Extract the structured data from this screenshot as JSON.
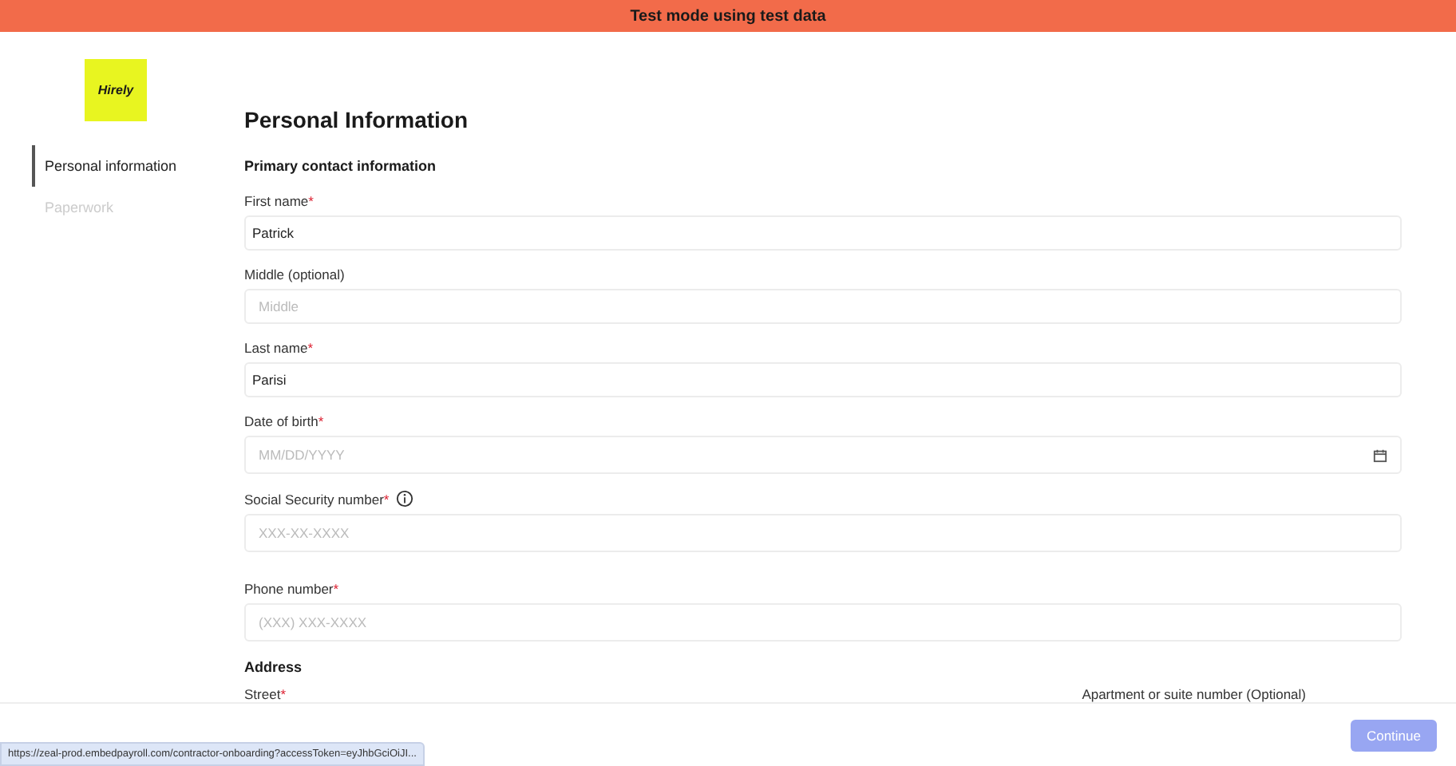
{
  "banner": {
    "text": "Test mode using test data"
  },
  "logo": {
    "text": "Hirely"
  },
  "sidebar": {
    "items": [
      {
        "label": "Personal information",
        "selected": true
      },
      {
        "label": "Paperwork",
        "selected": false
      }
    ]
  },
  "page": {
    "title": "Personal Information",
    "section": "Primary contact information"
  },
  "fields": [
    {
      "kind": "text",
      "label": "First name",
      "required_mark": "*",
      "value": "Patrick"
    },
    {
      "kind": "text",
      "label": "Middle (optional)",
      "placeholder": "Middle"
    },
    {
      "kind": "text",
      "label": "Last name",
      "required_mark": "*",
      "value": "Parisi"
    },
    {
      "kind": "date",
      "label": "Date of birth",
      "required_mark": "*",
      "placeholder": "MM/DD/YYYY"
    },
    {
      "kind": "info",
      "label": "Social Security number",
      "required_mark": "*",
      "placeholder": "XXX-XX-XXXX"
    },
    {
      "kind": "text",
      "label": "Phone number",
      "required_mark": "*",
      "placeholder": "(XXX) XXX-XXXX"
    }
  ],
  "address": {
    "title": "Address",
    "street_label": "Street",
    "street_required_mark": "*",
    "apt_label": "Apartment or suite number (Optional)"
  },
  "footer": {
    "button": "Continue",
    "disabled": true
  },
  "status_url": "https://zeal-prod.embedpayroll.com/contractor-onboarding?accessToken=eyJhbGciOiJI..."
}
